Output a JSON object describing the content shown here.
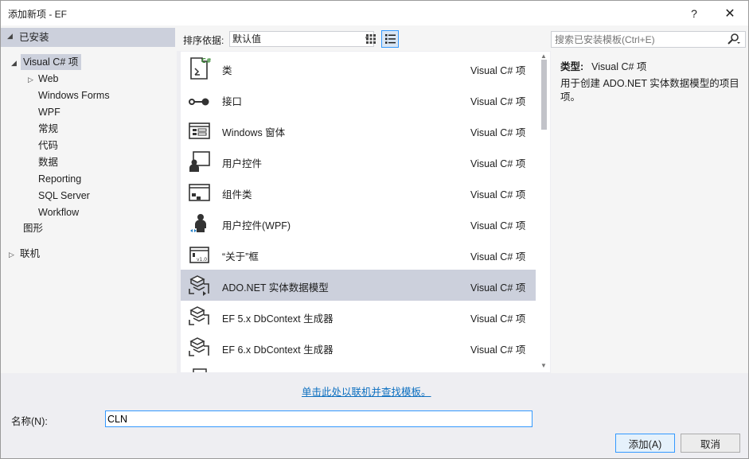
{
  "window": {
    "title": "添加新项 - EF",
    "help_label": "?",
    "close_label": "✕"
  },
  "tree": {
    "installed_label": "已安装",
    "items": [
      {
        "label": "Visual C# 项"
      },
      {
        "label": "Web"
      },
      {
        "label": "Windows Forms"
      },
      {
        "label": "WPF"
      },
      {
        "label": "常规"
      },
      {
        "label": "代码"
      },
      {
        "label": "数据"
      },
      {
        "label": "Reporting"
      },
      {
        "label": "SQL Server"
      },
      {
        "label": "Workflow"
      },
      {
        "label": "图形"
      },
      {
        "label": "联机"
      }
    ]
  },
  "toolbar": {
    "sort_label": "排序依据:",
    "sort_value": "默认值"
  },
  "templates": [
    {
      "name": "类",
      "type": "Visual C# 项",
      "icon": "class-icon"
    },
    {
      "name": "接口",
      "type": "Visual C# 项",
      "icon": "interface-icon"
    },
    {
      "name": "Windows 窗体",
      "type": "Visual C# 项",
      "icon": "windows-form-icon"
    },
    {
      "name": "用户控件",
      "type": "Visual C# 项",
      "icon": "user-control-icon"
    },
    {
      "name": "组件类",
      "type": "Visual C# 项",
      "icon": "component-class-icon"
    },
    {
      "name": "用户控件(WPF)",
      "type": "Visual C# 项",
      "icon": "wpf-user-control-icon"
    },
    {
      "name": "“关于”框",
      "type": "Visual C# 项",
      "icon": "about-box-icon"
    },
    {
      "name": "ADO.NET 实体数据模型",
      "type": "Visual C# 项",
      "icon": "entity-model-icon"
    },
    {
      "name": "EF 5.x DbContext 生成器",
      "type": "Visual C# 项",
      "icon": "dbcontext-generator-icon"
    },
    {
      "name": "EF 6.x DbContext 生成器",
      "type": "Visual C# 项",
      "icon": "dbcontext-generator-icon"
    }
  ],
  "search": {
    "placeholder": "搜索已安装模板(Ctrl+E)"
  },
  "details": {
    "type_label": "类型:",
    "type_value": "Visual C# 项",
    "description": "用于创建 ADO.NET 实体数据模型的项目项。"
  },
  "online_link": "单击此处以联机并查找模板。",
  "name_field": {
    "label": "名称(N):",
    "value": "CLN"
  },
  "buttons": {
    "add": "添加(A)",
    "cancel": "取消"
  }
}
